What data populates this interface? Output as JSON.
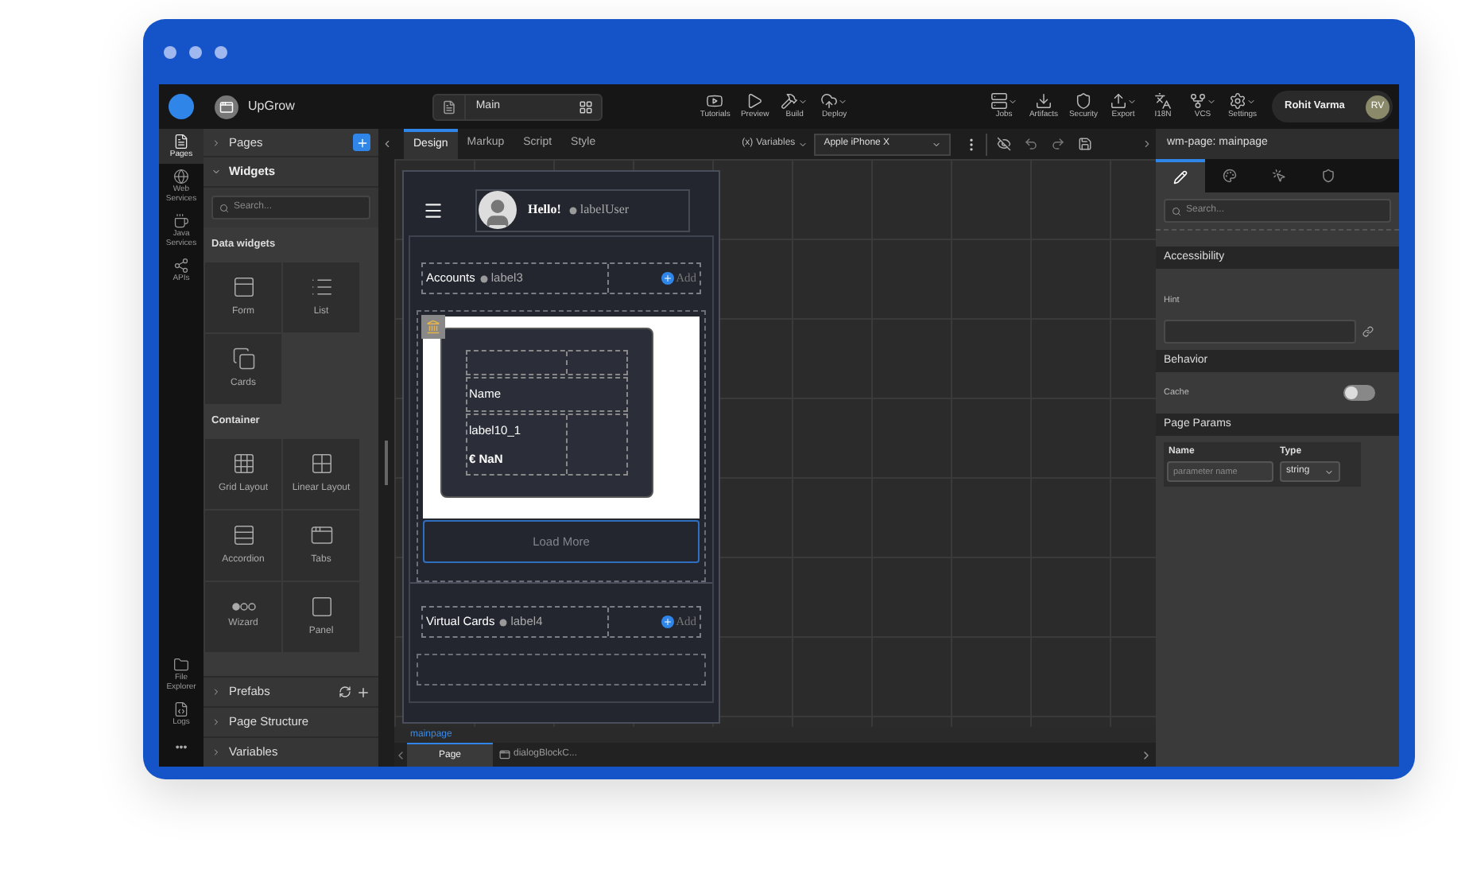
{
  "top_bar": {
    "project": "UpGrow",
    "page_selector": "Main",
    "tools": [
      {
        "label": "Tutorials",
        "kind": "tutorials",
        "menu": false
      },
      {
        "label": "Preview",
        "kind": "preview",
        "menu": false
      },
      {
        "label": "Build",
        "kind": "build",
        "menu": true
      },
      {
        "label": "Deploy",
        "kind": "deploy",
        "menu": true
      }
    ],
    "tools_right": [
      {
        "label": "Jobs",
        "kind": "jobs",
        "menu": true
      },
      {
        "label": "Artifacts",
        "kind": "artifacts",
        "menu": false
      },
      {
        "label": "Security",
        "kind": "security",
        "menu": false
      },
      {
        "label": "Export",
        "kind": "export",
        "menu": true
      },
      {
        "label": "I18N",
        "kind": "i18n",
        "menu": false
      },
      {
        "label": "VCS",
        "kind": "vcs",
        "menu": true
      },
      {
        "label": "Settings",
        "kind": "settings",
        "menu": true
      }
    ],
    "user": {
      "name": "Rohit Varma",
      "initials": "RV"
    }
  },
  "activity_bar": {
    "items": [
      {
        "label": "Pages",
        "kind": "pages",
        "selected": true
      },
      {
        "label": "Web Services",
        "kind": "web",
        "selected": false
      },
      {
        "label": "Java Services",
        "kind": "java",
        "selected": false
      },
      {
        "label": "APIs",
        "kind": "apis",
        "selected": false
      }
    ],
    "bottom_items": [
      {
        "label": "File Explorer",
        "kind": "files"
      },
      {
        "label": "Logs",
        "kind": "logs"
      }
    ],
    "more": "•••"
  },
  "left_panel": {
    "pages_section": {
      "label": "Pages",
      "expanded": false
    },
    "widgets_section": {
      "label": "Widgets",
      "expanded": true
    },
    "search": {
      "placeholder": "Search..."
    },
    "groups": [
      {
        "title": "Data widgets",
        "widgets": [
          {
            "label": "Form",
            "kind": "form"
          },
          {
            "label": "List",
            "kind": "list"
          },
          {
            "label": "Cards",
            "kind": "cards"
          }
        ]
      },
      {
        "title": "Container",
        "widgets": [
          {
            "label": "Grid Layout",
            "kind": "grid"
          },
          {
            "label": "Linear Layout",
            "kind": "linear"
          },
          {
            "label": "Accordion",
            "kind": "accordion"
          },
          {
            "label": "Tabs",
            "kind": "tabs"
          },
          {
            "label": "Wizard",
            "kind": "wizard"
          },
          {
            "label": "Panel",
            "kind": "panel"
          }
        ]
      }
    ],
    "bottom_sections": [
      {
        "label": "Prefabs",
        "kind": "prefabs",
        "expanded": false
      },
      {
        "label": "Page Structure",
        "kind": "structure",
        "expanded": false
      },
      {
        "label": "Variables",
        "kind": "variables",
        "expanded": false
      }
    ]
  },
  "editor": {
    "tabs": [
      {
        "label": "Design",
        "selected": true
      },
      {
        "label": "Markup",
        "selected": false
      },
      {
        "label": "Script",
        "selected": false
      },
      {
        "label": "Style",
        "selected": false
      }
    ],
    "variables": {
      "icon": "(x)",
      "label": "Variables"
    },
    "device": "Apple iPhone X"
  },
  "canvas": {
    "greeting": "Hello!",
    "user_label": "labelUser",
    "sections": [
      {
        "title": "Accounts",
        "label": "label3",
        "add": "Add",
        "kind": "cards"
      },
      {
        "title": "Virtual Cards",
        "label": "label4",
        "add": "Add",
        "kind": "empty"
      }
    ],
    "card": {
      "name": "Name",
      "label": "label10_1",
      "amount": "€ NaN"
    },
    "load_more": "Load More"
  },
  "footer": {
    "breadcrumb": "mainpage",
    "tabs": [
      {
        "label": "Page",
        "selected": true
      },
      {
        "label": "dialogBlockC...",
        "selected": false
      }
    ]
  },
  "properties": {
    "title": "wm-page: mainpage",
    "tabs": [
      {
        "kind": "edit",
        "selected": true
      },
      {
        "kind": "style",
        "selected": false
      },
      {
        "kind": "events",
        "selected": false
      },
      {
        "kind": "security",
        "selected": false
      }
    ],
    "search": {
      "placeholder": "Search..."
    },
    "accessibility": {
      "title": "Accessibility",
      "hint_label": "Hint"
    },
    "behavior": {
      "title": "Behavior",
      "cache_label": "Cache",
      "cache_on": false
    },
    "page_params": {
      "title": "Page Params",
      "columns": [
        "Name",
        "Type"
      ],
      "name_placeholder": "parameter name",
      "type": "string"
    }
  }
}
